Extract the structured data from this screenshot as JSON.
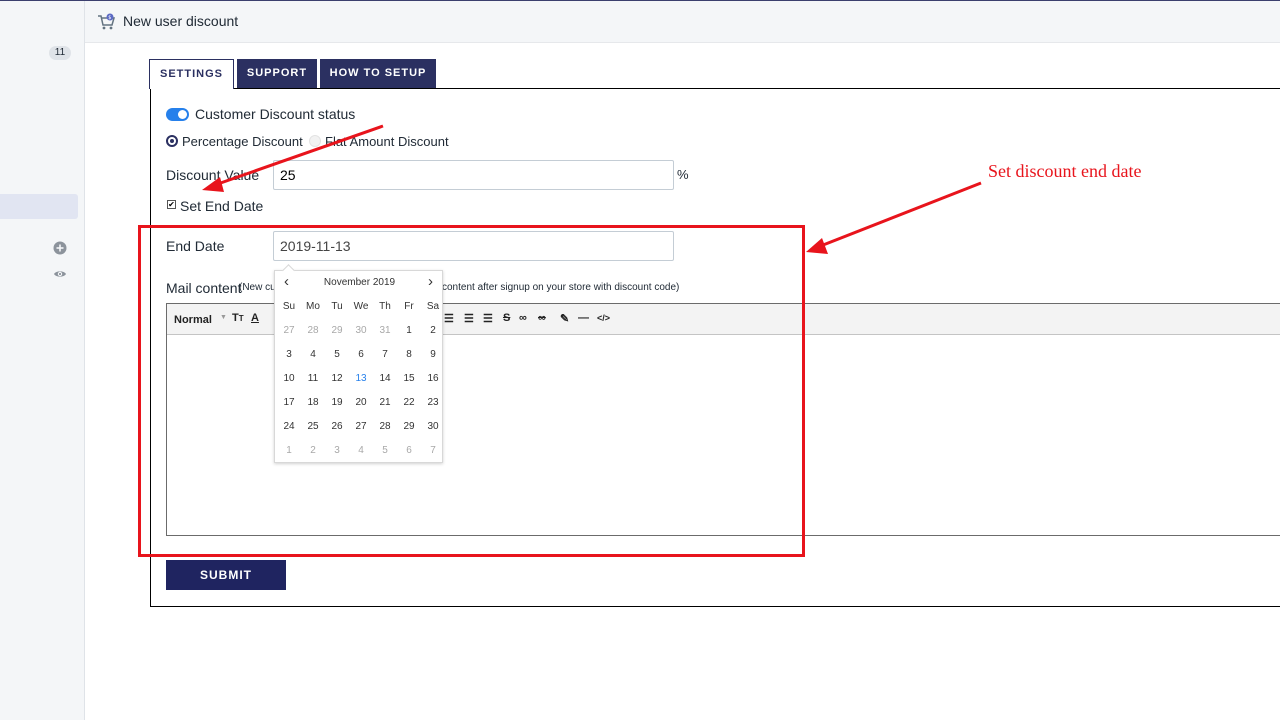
{
  "colors": {
    "accent": "#2b3061",
    "submit": "#1f2460",
    "toggle": "#2680eb",
    "annotation": "#e8141c",
    "today": "#2680eb"
  },
  "sidebar": {
    "badge": "11",
    "icons": [
      "plus-circle-icon",
      "eye-icon"
    ]
  },
  "header": {
    "icon": "cart-icon",
    "title": "New user discount"
  },
  "tabs": [
    {
      "label": "SETTINGS",
      "active": true
    },
    {
      "label": "SUPPORT",
      "active": false
    },
    {
      "label": "HOW TO SETUP",
      "active": false
    }
  ],
  "form": {
    "status_label": "Customer Discount status",
    "status_on": true,
    "radio_percentage": "Percentage Discount",
    "radio_flat": "Flat Amount Discount",
    "selected_type": "Percentage Discount",
    "discount_label": "Discount Value",
    "discount_value": "25",
    "discount_unit": "%",
    "set_end_date_label": "Set End Date",
    "set_end_date_checked": true,
    "end_date_label": "End Date",
    "end_date_value": "2019-11-13",
    "mail_label": "Mail content",
    "mail_hint_left": "(New cu",
    "mail_hint_right": "content after signup on your store with discount code)",
    "editor_format": "Normal",
    "submit_label": "SUBMIT"
  },
  "calendar": {
    "month": "November 2019",
    "prev": "‹",
    "next": "›",
    "weekdays": [
      "Su",
      "Mo",
      "Tu",
      "We",
      "Th",
      "Fr",
      "Sa"
    ],
    "weeks": [
      [
        "27",
        "28",
        "29",
        "30",
        "31",
        "1",
        "2"
      ],
      [
        "3",
        "4",
        "5",
        "6",
        "7",
        "8",
        "9"
      ],
      [
        "10",
        "11",
        "12",
        "13",
        "14",
        "15",
        "16"
      ],
      [
        "17",
        "18",
        "19",
        "20",
        "21",
        "22",
        "23"
      ],
      [
        "24",
        "25",
        "26",
        "27",
        "28",
        "29",
        "30"
      ],
      [
        "1",
        "2",
        "3",
        "4",
        "5",
        "6",
        "7"
      ]
    ],
    "selected": "13"
  },
  "annotation": {
    "text": "Set discount end date"
  }
}
